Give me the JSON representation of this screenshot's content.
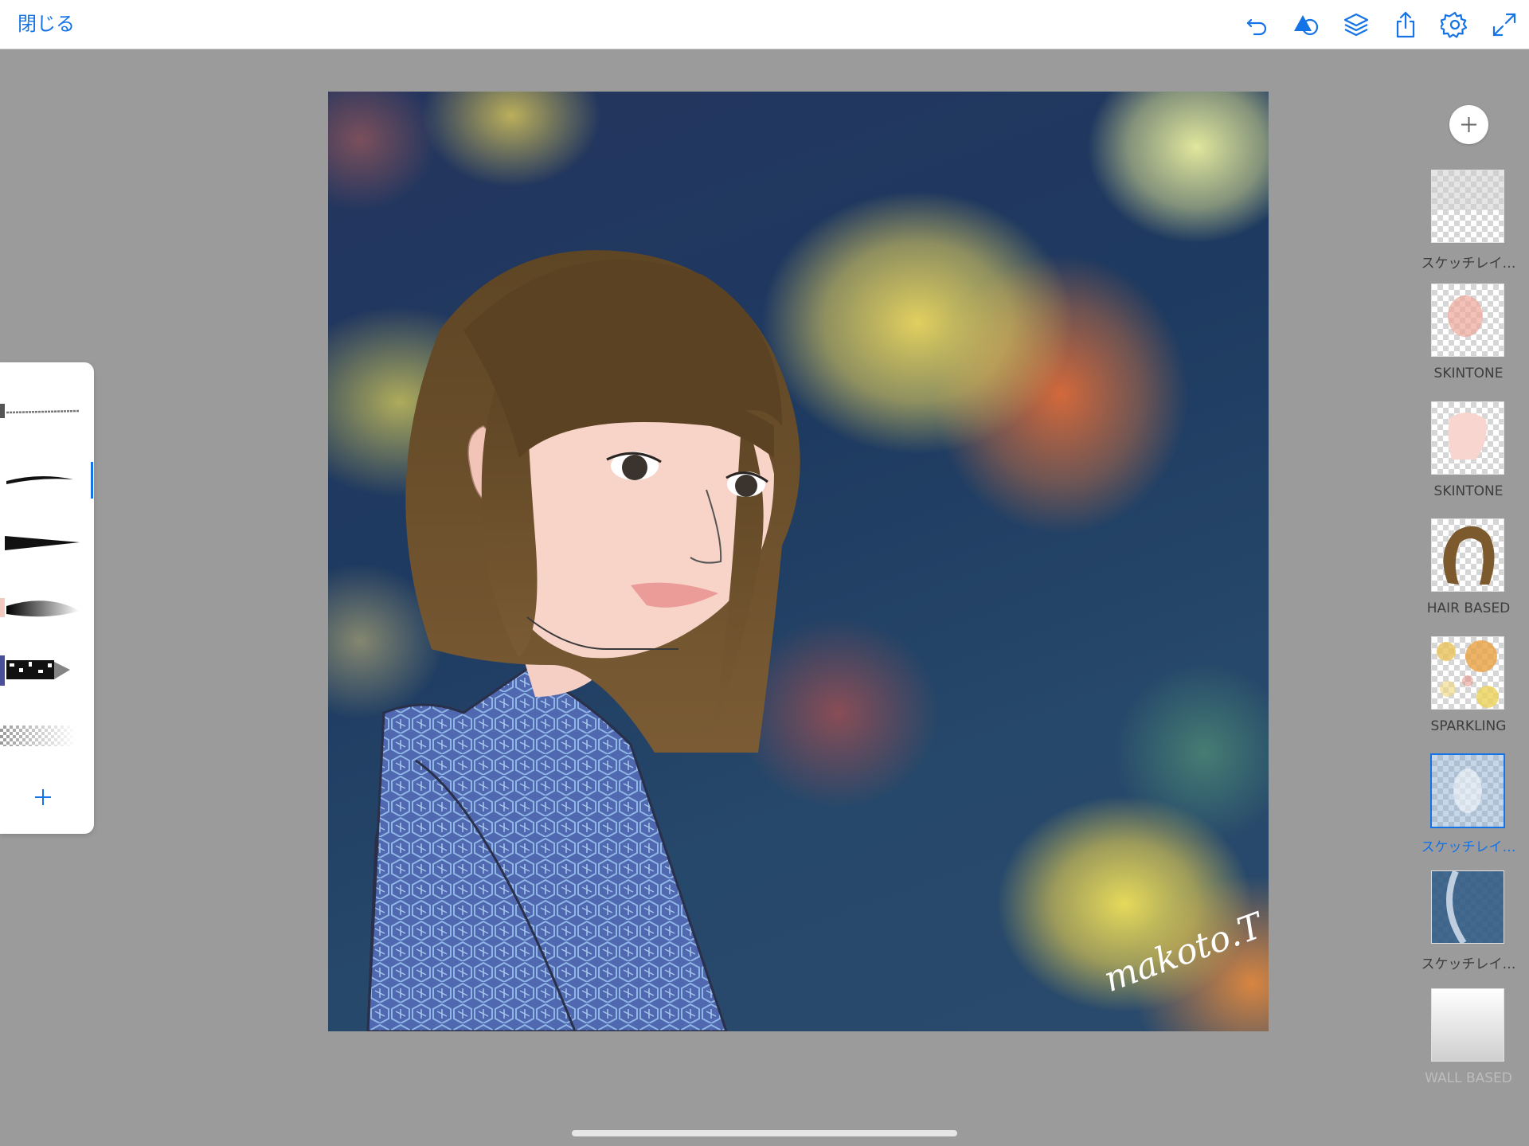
{
  "topbar": {
    "close_label": "閉じる",
    "icons": [
      "undo-icon",
      "shapes-icon",
      "layers-icon",
      "share-icon",
      "settings-icon",
      "fullscreen-icon"
    ],
    "accent_color": "#1473e6"
  },
  "artwork": {
    "signature": "makoto.T"
  },
  "brushes": {
    "items": [
      "pen-brush",
      "ink-brush",
      "marker-brush",
      "soft-brush",
      "texture-brush",
      "eraser-brush"
    ],
    "selected_index": 1,
    "add_label": "+"
  },
  "layers": {
    "add_label": "+",
    "items": [
      {
        "label": "スケッチレイ…",
        "state": "normal"
      },
      {
        "label": "SKINTONE",
        "state": "normal"
      },
      {
        "label": "SKINTONE",
        "state": "normal"
      },
      {
        "label": "HAIR BASED",
        "state": "normal"
      },
      {
        "label": "SPARKLING",
        "state": "normal"
      },
      {
        "label": "スケッチレイ…",
        "state": "active"
      },
      {
        "label": "スケッチレイ…",
        "state": "normal"
      },
      {
        "label": "WALL BASED",
        "state": "faded"
      }
    ]
  }
}
